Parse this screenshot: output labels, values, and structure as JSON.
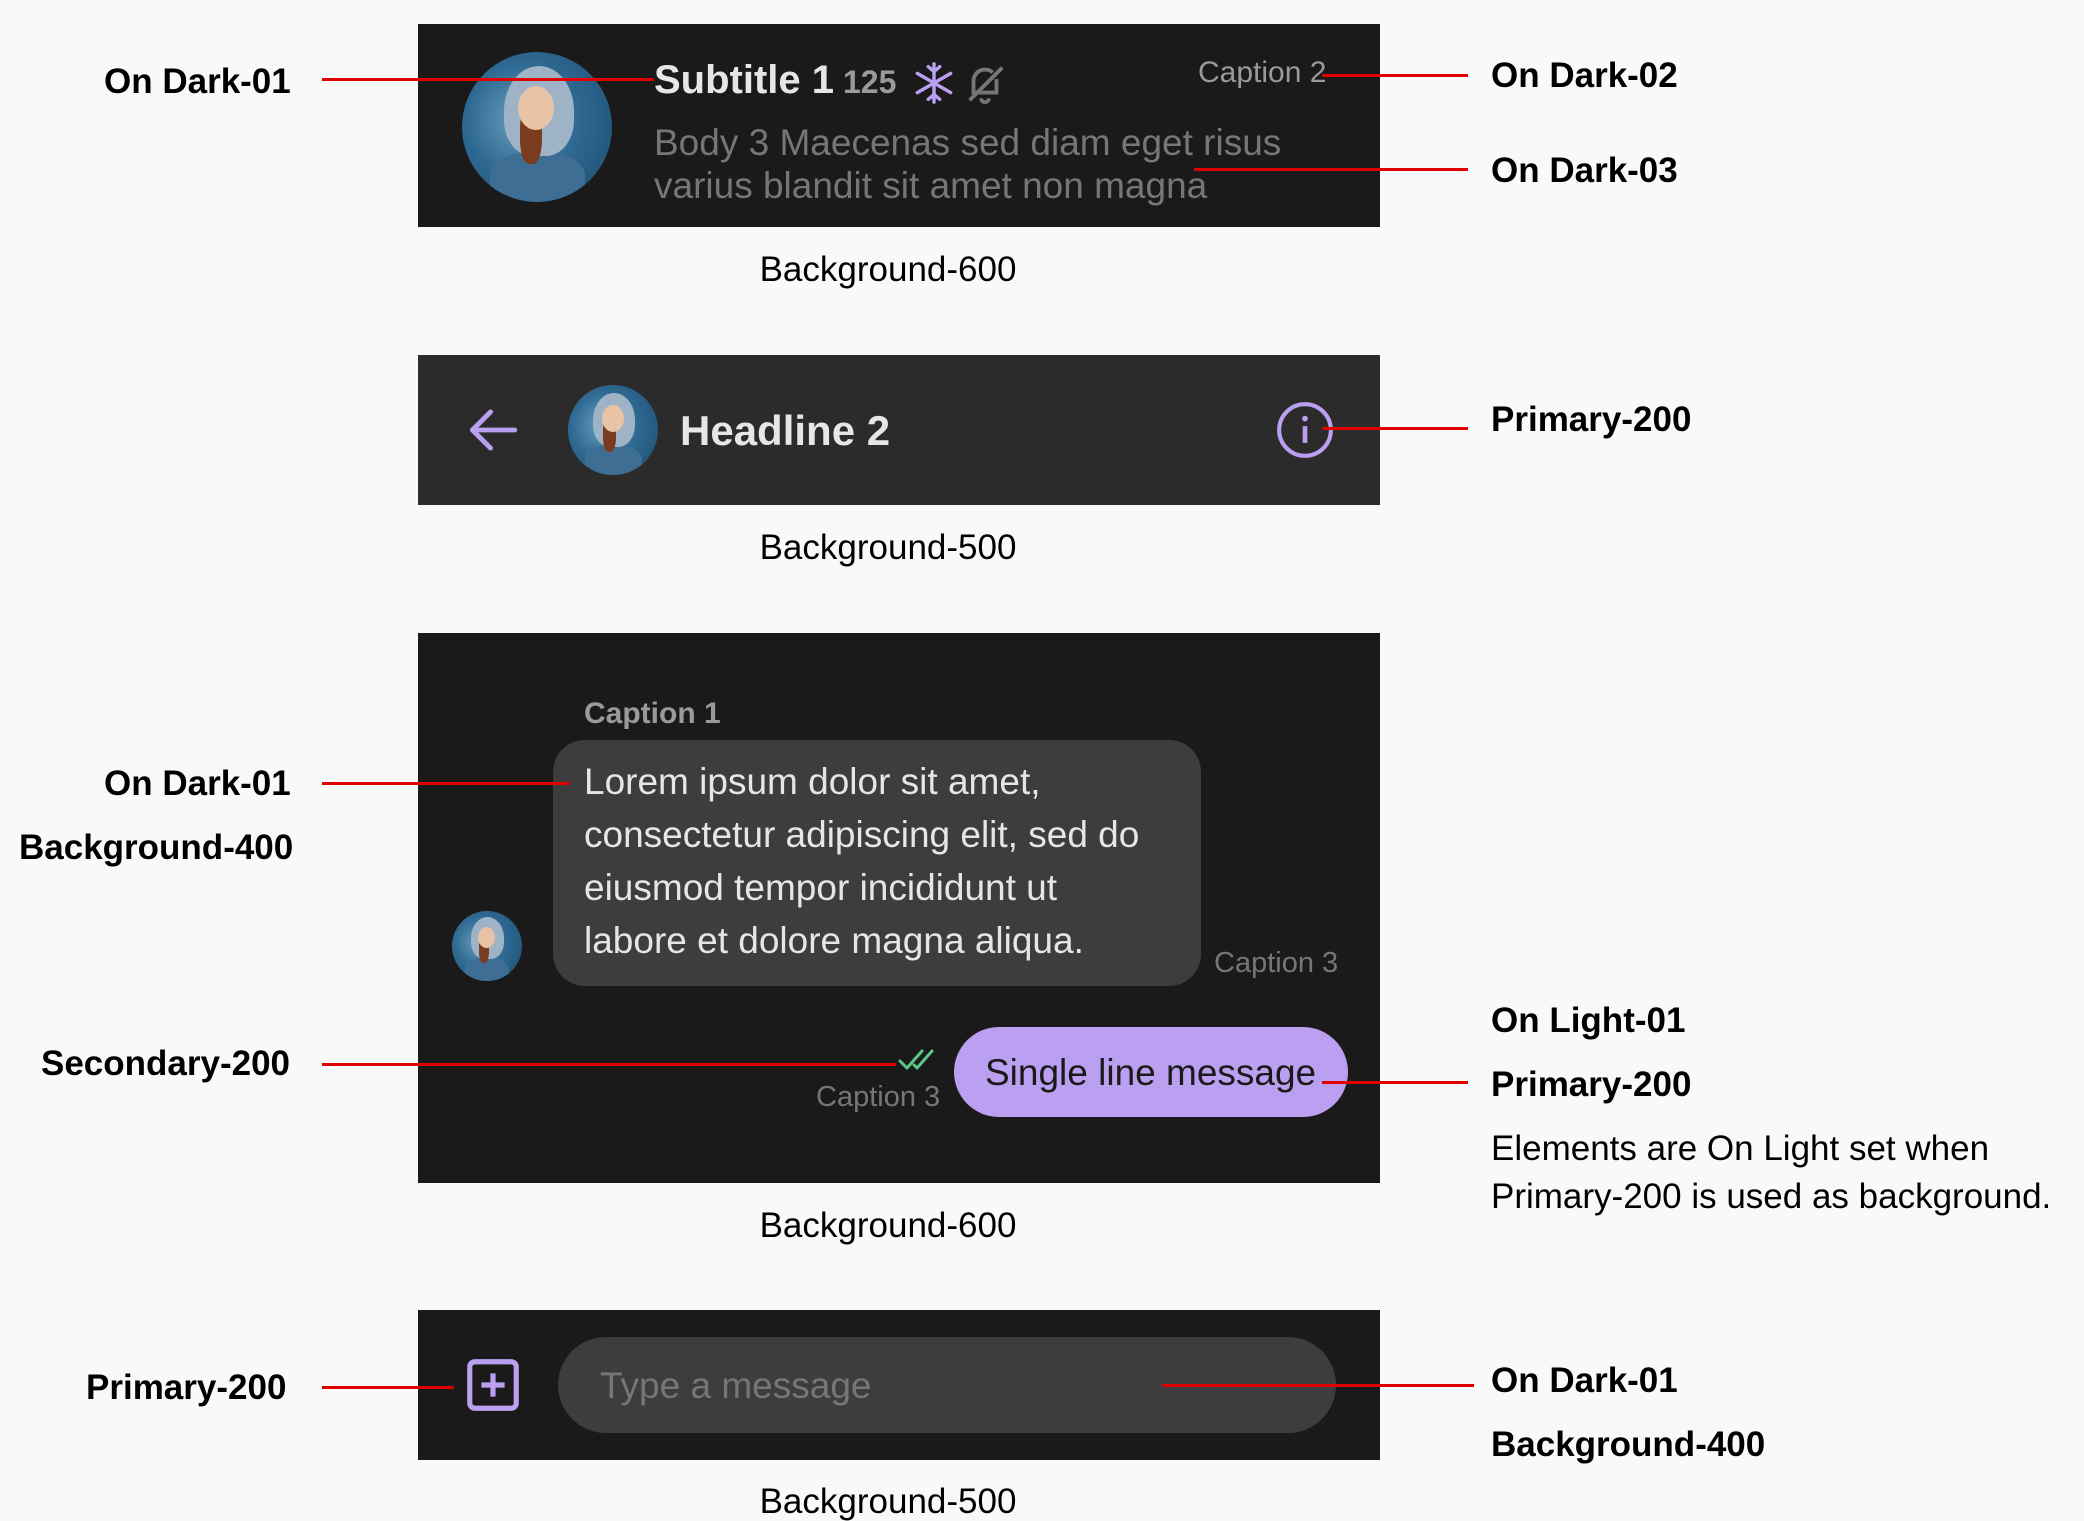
{
  "panel1": {
    "title": "Subtitle 1",
    "count": "125",
    "caption": "Caption 2",
    "body_line1": "Body 3 Maecenas sed diam eget risus",
    "body_line2": "varius blandit sit amet non magna",
    "bg_label": "Background-600",
    "icons": [
      "snowflake-icon",
      "bell-off-icon"
    ]
  },
  "panel2": {
    "title": "Headline 2",
    "bg_label": "Background-500",
    "icons": [
      "arrow-left-icon",
      "info-icon"
    ]
  },
  "panel3": {
    "caption1": "Caption 1",
    "bubble_lines": [
      "Lorem ipsum dolor sit amet,",
      "consectetur adipiscing elit, sed do",
      "eiusmod tempor incididunt ut",
      "labore et dolore magna aliqua."
    ],
    "caption3_left": "Caption 3",
    "caption3_right": "Caption 3",
    "sent_message": "Single line message",
    "bg_label": "Background-600",
    "icons": [
      "double-check-icon"
    ]
  },
  "panel4": {
    "placeholder": "Type a message",
    "bg_label": "Background-500",
    "icons": [
      "add-box-icon"
    ]
  },
  "annotations": {
    "on_dark_01_top": "On Dark-01",
    "on_dark_02": "On Dark-02",
    "on_dark_03": "On Dark-03",
    "primary_200_header": "Primary-200",
    "on_dark_01_bubble": "On Dark-01",
    "background_400_bubble": "Background-400",
    "secondary_200": "Secondary-200",
    "on_light_01": "On Light-01",
    "primary_200_sent": "Primary-200",
    "note_line1": "Elements are On Light set when",
    "note_line2": "Primary-200 is used as background.",
    "primary_200_input": "Primary-200",
    "on_dark_01_input": "On Dark-01",
    "background_400_input": "Background-400"
  },
  "colors": {
    "background_600": "#1a1a1a",
    "background_500": "#2b2b2b",
    "background_400": "#3d3d3d",
    "primary_200": "#bb9ff1",
    "secondary_200": "#5bc787",
    "on_dark_01": "#e6e6e6",
    "on_dark_02": "#9a9a9a",
    "on_dark_03": "#767676",
    "on_light_01": "#1a1a1a",
    "annotation_line": "#e00000"
  }
}
